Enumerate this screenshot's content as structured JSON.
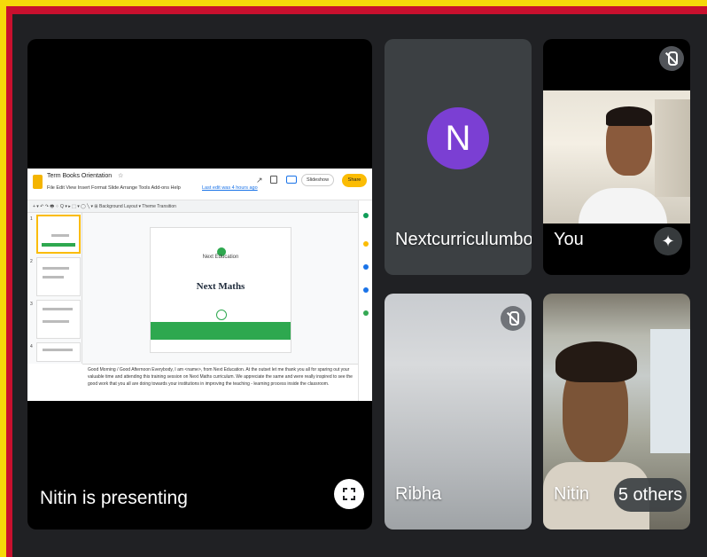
{
  "presentation": {
    "doc_title": "Term Books Orientation",
    "menu_items": "File  Edit  View  Insert  Format  Slide  Arrange  Tools  Add-ons  Help",
    "last_edit": "Last edit was 4 hours ago",
    "slideshow_label": "Slideshow",
    "share_label": "Share",
    "avatar_initial": "N",
    "toolbar_text": "+ ▾  ↶ ↷ 🖶 ⁘  Q ▾  ▸ ⬚ ▾ ◯ ╲ ▾  ⊞  Background  Layout ▾  Theme  Transition",
    "slide_numbers": [
      "1",
      "2",
      "3",
      "4"
    ],
    "slide_logo_text": "Next Education",
    "slide_brand": "Next Maths",
    "notes_text": "Good Morning / Good Afternoon Everybody,\nI am <name>, from Next Education. At the outset let me thank you all for sparing out your valuable time and attending this training session on Next Maths curriculum. We appreciate the same and were really inspired to see the good work that you all are doing towards your institutions in improving the teaching - learning process inside the classroom.",
    "presenter_label": "Nitin is presenting"
  },
  "participants": {
    "ncb": {
      "initial": "N",
      "name": "Nextcurriculumbooks",
      "avatar_color": "#7b3fd3"
    },
    "you": {
      "name": "You"
    },
    "ribha": {
      "name": "Ribha"
    },
    "nitin": {
      "name": "Nitin",
      "others": "5 others"
    }
  },
  "colors": {
    "frame_outer": "#f5d90a",
    "frame_inner": "#c8102e",
    "stage_bg": "#202124",
    "tile_bg": "#3c4043"
  }
}
